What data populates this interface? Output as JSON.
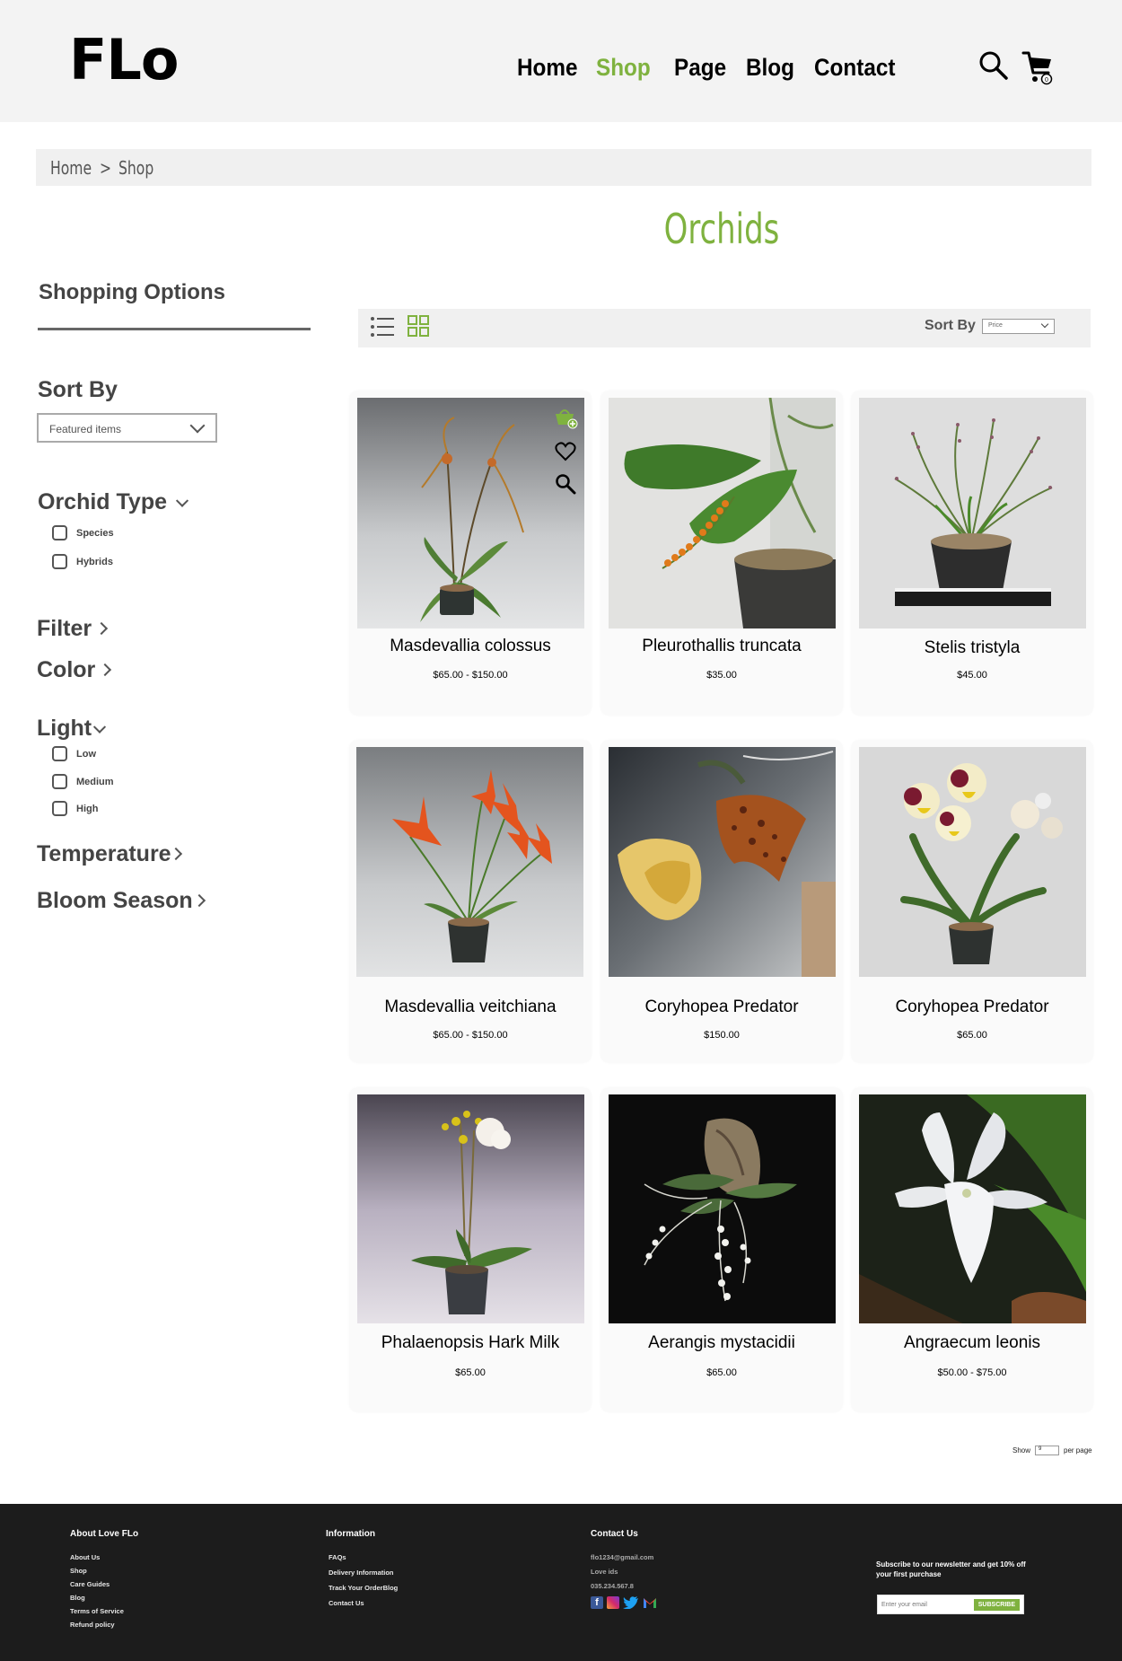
{
  "header": {
    "logo": "FLo",
    "nav": [
      "Home",
      "Shop",
      "Page",
      "Blog",
      "Contact"
    ],
    "active_nav": "Shop",
    "cart_count": "0"
  },
  "breadcrumb": {
    "home": "Home",
    "separator": ">",
    "current": "Shop"
  },
  "page_title": "Orchids",
  "sidebar": {
    "heading": "Shopping Options",
    "sort_by_label": "Sort By",
    "sort_by_value": "Featured items",
    "orchid_type": {
      "label": "Orchid Type",
      "options": [
        "Species",
        "Hybrids"
      ]
    },
    "filter_label": "Filter",
    "color_label": "Color",
    "light": {
      "label": "Light",
      "options": [
        "Low",
        "Medium",
        "High"
      ]
    },
    "temperature_label": "Temperature",
    "bloom_season_label": "Bloom Season"
  },
  "toolbar": {
    "sort_by_label": "Sort By",
    "sort_by_value": "Price"
  },
  "products": [
    {
      "name": "Masdevallia colossus",
      "price": "$65.00 - $150.00"
    },
    {
      "name": "Pleurothallis truncata",
      "price": "$35.00"
    },
    {
      "name": "Stelis tristyla",
      "price": "$45.00"
    },
    {
      "name": "Masdevallia veitchiana",
      "price": "$65.00 - $150.00"
    },
    {
      "name": "Coryhopea Predator",
      "price": "$150.00"
    },
    {
      "name": "Coryhopea Predator",
      "price": "$65.00"
    },
    {
      "name": "Phalaenopsis Hark Milk",
      "price": "$65.00"
    },
    {
      "name": "Aerangis mystacidii",
      "price": "$65.00"
    },
    {
      "name": "Angraecum leonis",
      "price": "$50.00 - $75.00"
    }
  ],
  "pagination": {
    "show_label": "Show",
    "per_page_value": "9",
    "per_page_label": "per page"
  },
  "footer": {
    "about": {
      "heading": "About Love FLo",
      "links": [
        "About Us",
        "Shop",
        "Care Guides",
        "Blog",
        "Terms of Service",
        "Refund policy"
      ]
    },
    "information": {
      "heading": "Information",
      "links": [
        "FAQs",
        "Delivery Information",
        "Track Your OrderBlog",
        "Contact Us"
      ]
    },
    "contact": {
      "heading": "Contact Us",
      "email": "flo1234@gmail.com",
      "name": "Love ids",
      "phone": "035.234.567.8"
    },
    "newsletter": {
      "text": "Subscribe to our newsletter and get 10% off your first purchase",
      "placeholder": "Enter your email",
      "button": "SUBSCRIBE"
    }
  },
  "colors": {
    "accent": "#7fb23f",
    "footer_bg": "#1c1c1c",
    "header_bg": "#f3f3f3"
  }
}
